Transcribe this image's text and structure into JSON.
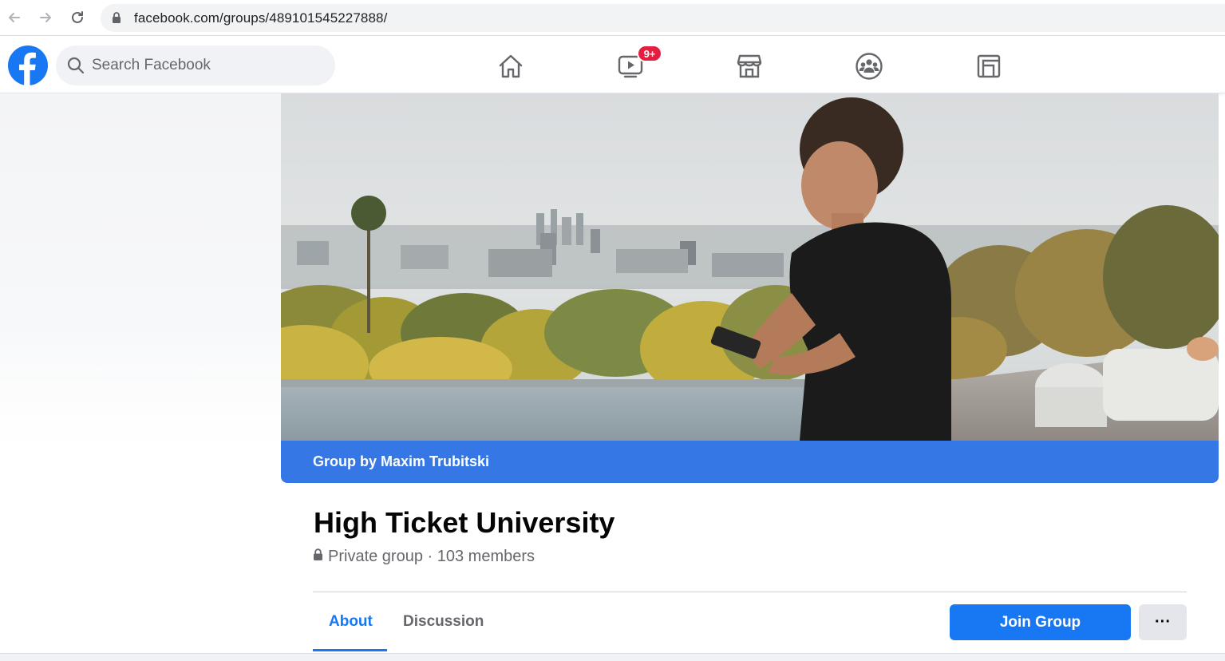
{
  "browser": {
    "url": "facebook.com/groups/489101545227888/"
  },
  "header": {
    "search_placeholder": "Search Facebook",
    "watch_badge": "9+",
    "nav_icons": [
      "home-icon",
      "watch-icon",
      "marketplace-icon",
      "groups-icon",
      "gaming-icon"
    ]
  },
  "cover": {
    "banner_text": "Group by Maxim Trubitski"
  },
  "group": {
    "title": "High Ticket University",
    "meta": "Private group · 103 members"
  },
  "tabs": [
    {
      "label": "About",
      "active": true
    },
    {
      "label": "Discussion",
      "active": false
    }
  ],
  "actions": {
    "join_label": "Join Group",
    "more_label": "···"
  },
  "colors": {
    "brand_blue": "#1877f2",
    "banner_blue": "#3578e5",
    "badge_red": "#e41e3f"
  }
}
